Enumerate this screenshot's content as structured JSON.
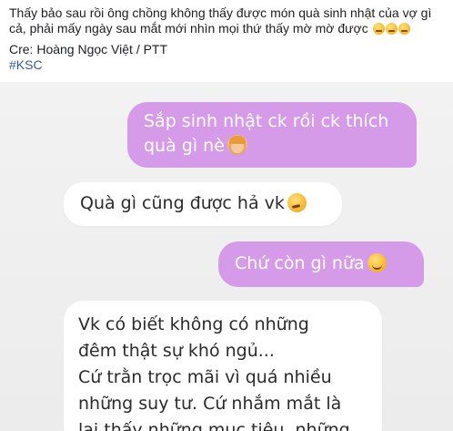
{
  "post": {
    "line1": "Thấy bảo sau rồi ông chồng không thấy được món quà sinh nhật của vợ gì",
    "line2": "cả, phải mấy ngày sau mắt mới nhìn mọi thứ thấy mờ mờ được",
    "emoji": [
      "tired-face-icon",
      "tired-face-icon",
      "tired-face-icon"
    ],
    "credit": "Cre: Hoàng Ngọc Việt / PTT",
    "hashtag": "#KSC"
  },
  "chat": {
    "messages": [
      {
        "sender": "me",
        "lines": [
          "Sắp sinh nhật ck rồi ck thích",
          "quà gì nè"
        ],
        "emoji": "woman-tipping-hand-icon"
      },
      {
        "sender": "them",
        "lines": [
          "Quà gì cũng được hả vk"
        ],
        "emoji": "thinking-face-icon"
      },
      {
        "sender": "me",
        "lines": [
          "Chứ còn gì nữa"
        ],
        "emoji": "relieved-face-icon"
      },
      {
        "sender": "them",
        "lines": [
          "Vk có biết không có những",
          "đêm thật sự khó ngủ...",
          "Cứ trằn trọc mãi vì quá nhiều",
          "những suy tư. Cứ nhắm mắt là",
          "lại thấy những mục tiêu, những"
        ]
      }
    ]
  },
  "colors": {
    "outgoing_bubble": "#d59ae8",
    "incoming_bubble": "#ffffff",
    "chat_background": "#ececec",
    "hashtag": "#385898"
  }
}
